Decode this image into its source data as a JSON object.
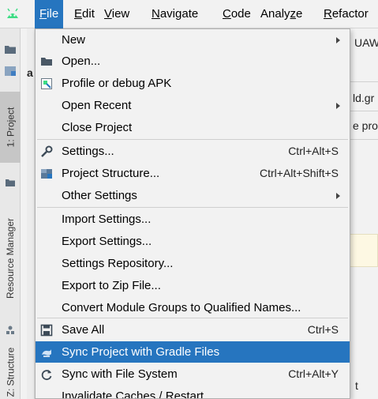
{
  "menubar": {
    "items": [
      {
        "label": "File",
        "mnemonic": "F",
        "rest": "ile",
        "active": true
      },
      {
        "label": "Edit",
        "mnemonic": "E",
        "rest": "dit"
      },
      {
        "label": "View",
        "mnemonic": "V",
        "rest": "iew"
      },
      {
        "label": "Navigate",
        "mnemonic": "N",
        "rest": "avigate"
      },
      {
        "label": "Code",
        "mnemonic": "C",
        "rest": "ode"
      },
      {
        "label": "Analyze",
        "pre": "Analy",
        "mnemonic": "z",
        "rest": "e"
      },
      {
        "label": "Refactor",
        "mnemonic": "R",
        "rest": "efactor"
      }
    ]
  },
  "toolstrip": {
    "project": "1: Project",
    "resource_manager": "Resource Manager",
    "structure": "Z: Structure"
  },
  "background": {
    "snip1": "UAW",
    "snip2": "a",
    "snip3": "ld.gr",
    "snip4": "e pro",
    "snip5": "t"
  },
  "file_menu": {
    "items": [
      {
        "label": "New",
        "icon": "none",
        "submenu": true
      },
      {
        "label": "Open...",
        "icon": "folder-icon"
      },
      {
        "label": "Profile or debug APK",
        "icon": "apk-icon"
      },
      {
        "label": "Open Recent",
        "icon": "none",
        "submenu": true
      },
      {
        "label": "Close Project",
        "icon": "none"
      },
      {
        "label": "Settings...",
        "icon": "wrench-icon",
        "shortcut": "Ctrl+Alt+S"
      },
      {
        "label": "Project Structure...",
        "icon": "project-structure-icon",
        "shortcut": "Ctrl+Alt+Shift+S"
      },
      {
        "label": "Other Settings",
        "icon": "none",
        "submenu": true
      },
      {
        "label": "Import Settings...",
        "icon": "none"
      },
      {
        "label": "Export Settings...",
        "icon": "none"
      },
      {
        "label": "Settings Repository...",
        "icon": "none"
      },
      {
        "label": "Export to Zip File...",
        "icon": "none"
      },
      {
        "label": "Convert Module Groups to Qualified Names...",
        "icon": "none"
      },
      {
        "label": "Save All",
        "icon": "save-icon",
        "shortcut": "Ctrl+S"
      },
      {
        "label": "Sync Project with Gradle Files",
        "icon": "gradle-sync-icon",
        "selected": true
      },
      {
        "label": "Sync with File System",
        "icon": "refresh-icon",
        "shortcut": "Ctrl+Alt+Y"
      },
      {
        "label": "Invalidate Caches / Restart...",
        "icon": "none"
      }
    ]
  },
  "colors": {
    "accent": "#2675bf",
    "menu_bg": "#f2f2f2",
    "android_green": "#3ddc84"
  }
}
